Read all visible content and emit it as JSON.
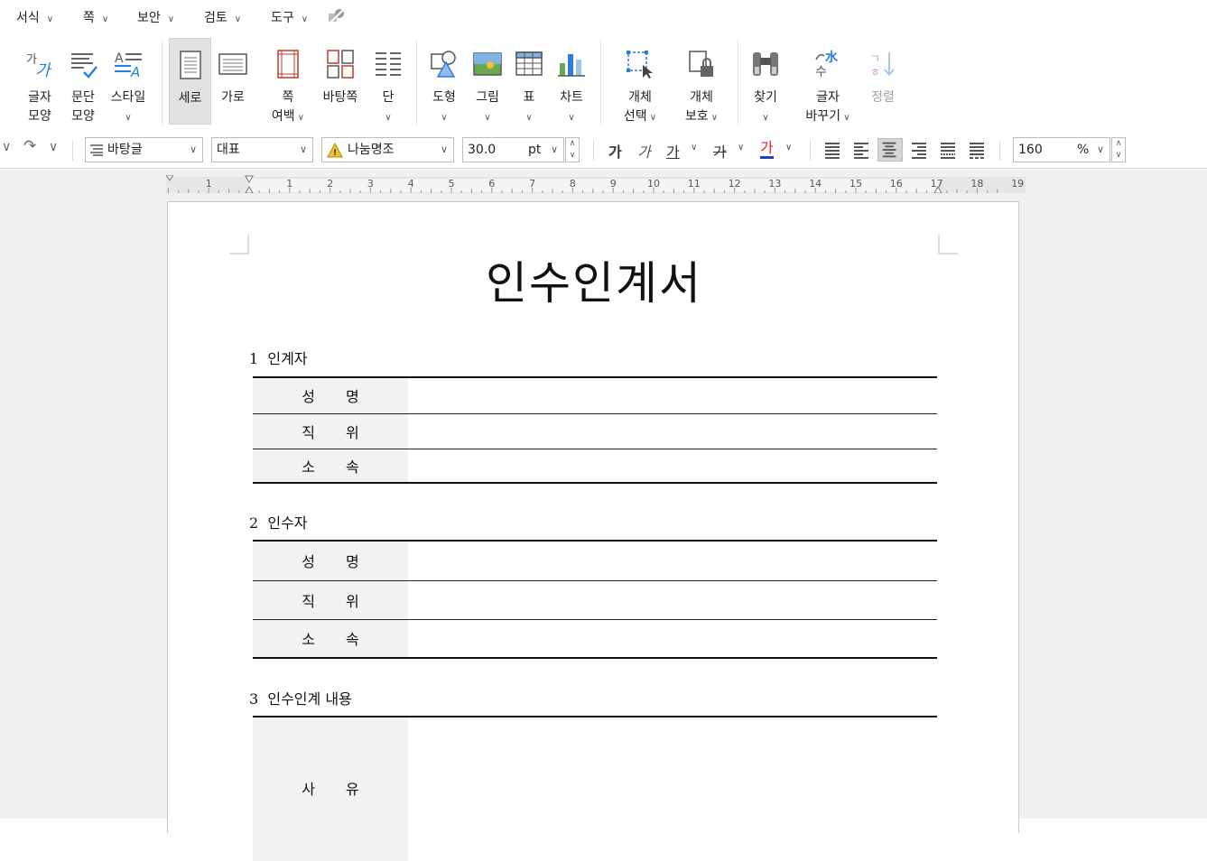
{
  "menubar": {
    "items": [
      {
        "label": "서식"
      },
      {
        "label": "쪽"
      },
      {
        "label": "보안"
      },
      {
        "label": "검토"
      },
      {
        "label": "도구"
      }
    ]
  },
  "ribbon": {
    "char_shape": {
      "label": "글자\n모양"
    },
    "para_shape": {
      "label": "문단\n모양"
    },
    "style": {
      "label": "스타일"
    },
    "portrait": {
      "label": "세로"
    },
    "landscape": {
      "label": "가로"
    },
    "page_margin": {
      "label": "쪽\n여백"
    },
    "page_background": {
      "label": "바탕쪽"
    },
    "columns": {
      "label": "단"
    },
    "shape": {
      "label": "도형"
    },
    "picture": {
      "label": "그림"
    },
    "table": {
      "label": "표"
    },
    "chart": {
      "label": "차트"
    },
    "object_select": {
      "label": "개체\n선택"
    },
    "object_protect": {
      "label": "개체\n보호"
    },
    "find": {
      "label": "찾기"
    },
    "replace_chars": {
      "label": "글자\n바꾸기"
    },
    "sort": {
      "label": "정렬"
    }
  },
  "toolbar": {
    "style_select": "바탕글",
    "lang_select": "대표",
    "font_select": "나눔명조",
    "font_size": "30.0",
    "font_unit": "pt",
    "bold_glyph": "가",
    "italic_glyph": "가",
    "underline_glyph": "가",
    "strike_glyph": "가",
    "color_glyph": "가",
    "zoom_value": "160",
    "zoom_unit": "%",
    "text_color": "#d9262c",
    "text_color_bar": "#1f3fbf"
  },
  "ruler": {
    "labels": [
      "1",
      "1",
      "2",
      "3",
      "4",
      "5",
      "6",
      "7",
      "8",
      "9",
      "10",
      "11",
      "12",
      "13",
      "14",
      "15",
      "16",
      "17",
      "18",
      "19"
    ]
  },
  "document": {
    "title": "인수인계서",
    "sections": [
      {
        "heading": "1  인계자",
        "rows": [
          {
            "label": "성명"
          },
          {
            "label": "직위"
          },
          {
            "label": "소속"
          }
        ]
      },
      {
        "heading": "2  인수자",
        "rows": [
          {
            "label": "성명"
          },
          {
            "label": "직위"
          },
          {
            "label": "소속"
          }
        ]
      },
      {
        "heading": "3  인수인계 내용",
        "rows": [
          {
            "label": "사유"
          }
        ]
      }
    ]
  },
  "colors": {
    "accent_blue": "#2a7de1",
    "active_button": "#e2e2e2",
    "label_cell": "#f2f2f2",
    "workspace": "#f0f0f0"
  }
}
